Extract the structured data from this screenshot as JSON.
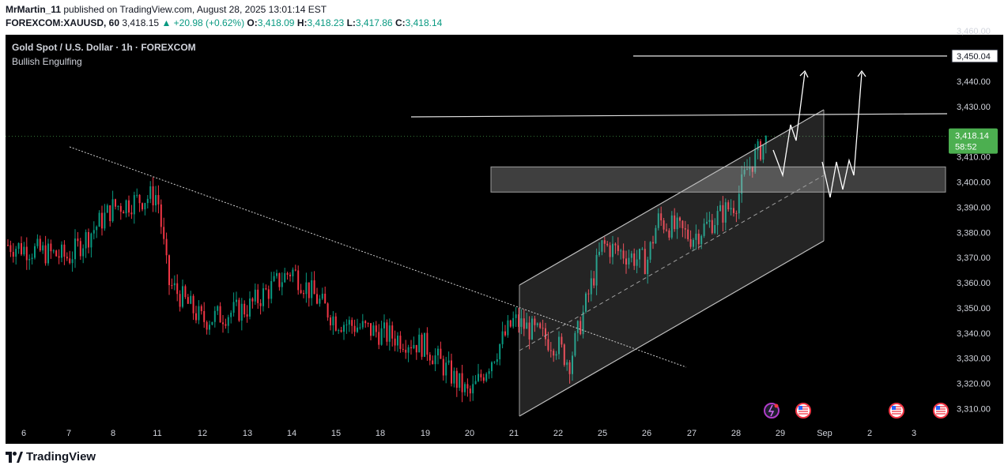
{
  "header": {
    "author": "MrMartin_11",
    "published_text": "published on TradingView.com, August 28, 2025 13:01:14 EST",
    "symbol": "FOREXCOM:XAUUSD, 60",
    "last": "3,418.15",
    "change": "+20.98 (+0.62%)",
    "o_label": "O:",
    "o": "3,418.09",
    "h_label": "H:",
    "h": "3,418.23",
    "l_label": "L:",
    "l": "3,417.86",
    "c_label": "C:",
    "c": "3,418.14"
  },
  "legend": {
    "title": "Gold Spot / U.S. Dollar · 1h · FOREXCOM",
    "indicator": "Bullish Engulfing"
  },
  "brand": "TradingView",
  "colors": {
    "up": "#089981",
    "down": "#f23645",
    "price_badge": "#4caf50"
  },
  "chart_data": {
    "type": "candlestick",
    "y_ticks": [
      "3,310.00",
      "3,320.00",
      "3,330.00",
      "3,340.00",
      "3,350.00",
      "3,360.00",
      "3,370.00",
      "3,380.00",
      "3,390.00",
      "3,400.00",
      "3,410.00",
      "3,420.00",
      "3,430.00",
      "3,440.00",
      "3,450.00",
      "3,460.00"
    ],
    "ylim": [
      3307,
      3461
    ],
    "x_ticks": [
      "6",
      "7",
      "8",
      "11",
      "12",
      "13",
      "14",
      "15",
      "18",
      "19",
      "20",
      "21",
      "22",
      "25",
      "26",
      "27",
      "28",
      "29",
      "Sep",
      "2",
      "3"
    ],
    "current_price": {
      "label": "3,418.14",
      "countdown": "58:52",
      "value": 3418.14
    },
    "target_level": {
      "label": "3,450.04",
      "value": 3450.04
    },
    "resistance_level": 3426.5,
    "support_zone": [
      3396,
      3406
    ],
    "approx_path": [
      [
        "6",
        3375
      ],
      [
        "7",
        3370
      ],
      [
        "8",
        3390
      ],
      [
        "11",
        3395
      ],
      [
        "11",
        3360
      ],
      [
        "12",
        3345
      ],
      [
        "13",
        3350
      ],
      [
        "14",
        3365
      ],
      [
        "15",
        3345
      ],
      [
        "18",
        3340
      ],
      [
        "19",
        3335
      ],
      [
        "20",
        3315
      ],
      [
        "21",
        3345
      ],
      [
        "22",
        3335
      ],
      [
        "22",
        3328
      ],
      [
        "25",
        3375
      ],
      [
        "26",
        3368
      ],
      [
        "26",
        3385
      ],
      [
        "27",
        3378
      ],
      [
        "28",
        3392
      ],
      [
        "28",
        3405
      ],
      [
        "28",
        3418
      ]
    ]
  }
}
